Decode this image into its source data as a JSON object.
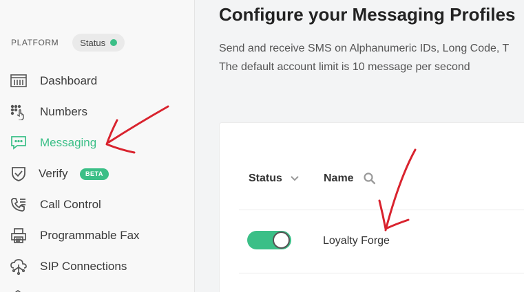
{
  "sidebar": {
    "section_label": "PLATFORM",
    "status_label": "Status",
    "status_color": "#3bbf87",
    "items": [
      {
        "label": "Dashboard",
        "icon": "dashboard-icon",
        "active": false
      },
      {
        "label": "Numbers",
        "icon": "keypad-icon",
        "active": false
      },
      {
        "label": "Messaging",
        "icon": "message-icon",
        "active": true
      },
      {
        "label": "Verify",
        "icon": "shield-check-icon",
        "active": false,
        "badge": "BETA"
      },
      {
        "label": "Call Control",
        "icon": "phone-icon",
        "active": false
      },
      {
        "label": "Programmable Fax",
        "icon": "fax-icon",
        "active": false
      },
      {
        "label": "SIP Connections",
        "icon": "cloud-connection-icon",
        "active": false
      }
    ]
  },
  "main": {
    "title": "Configure your Messaging Profiles",
    "description_line1": "Send and receive SMS on Alphanumeric IDs, Long Code, T",
    "description_line2": "The default account limit is 10 message per second",
    "table": {
      "columns": [
        "Status",
        "Name"
      ],
      "rows": [
        {
          "status_on": true,
          "name": "Loyalty Forge"
        }
      ]
    }
  },
  "colors": {
    "accent": "#3bbf87",
    "annotation": "#d9232e"
  }
}
